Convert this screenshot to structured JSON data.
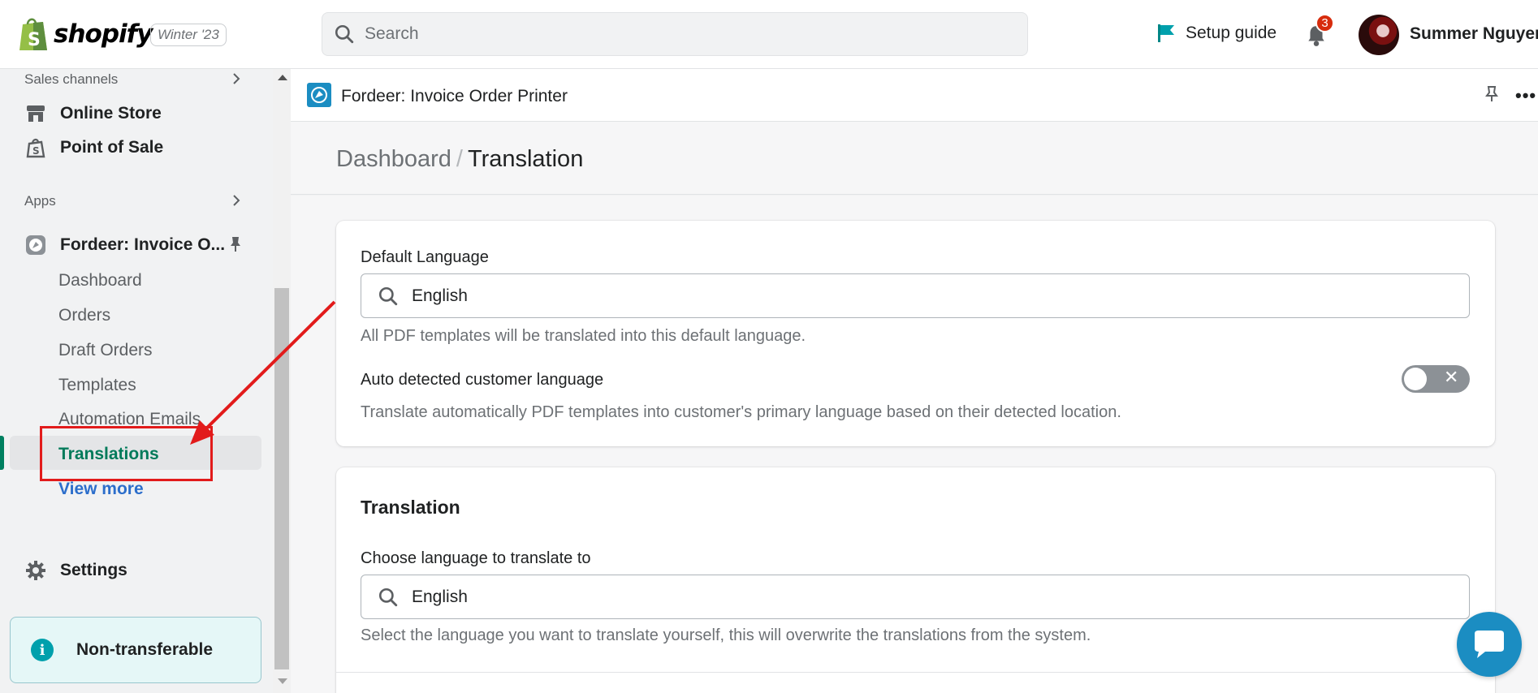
{
  "topbar": {
    "brand": "shopify",
    "version_badge": "Winter '23",
    "search_placeholder": "Search",
    "setup_guide": "Setup guide",
    "notification_count": "3",
    "user_name": "Summer Nguyen"
  },
  "sidebar": {
    "sales_channels_title": "Sales channels",
    "online_store": "Online Store",
    "point_of_sale": "Point of Sale",
    "apps_title": "Apps",
    "app_name": "Fordeer: Invoice O...",
    "sub_items": [
      "Dashboard",
      "Orders",
      "Draft Orders",
      "Templates",
      "Automation Emails"
    ],
    "active_item": "Translations",
    "view_more": "View more",
    "settings": "Settings",
    "banner": "Non-transferable"
  },
  "app": {
    "title": "Fordeer: Invoice Order Printer",
    "breadcrumb_parent": "Dashboard",
    "breadcrumb_separator": "/",
    "breadcrumb_current": "Translation"
  },
  "card1": {
    "default_language_label": "Default Language",
    "default_language_value": "English",
    "default_language_help": "All PDF templates will be translated into this default language.",
    "auto_detect_label": "Auto detected customer language",
    "auto_detect_help": "Translate automatically PDF templates into customer's primary language based on their detected location.",
    "auto_detect_enabled": false
  },
  "card2": {
    "title": "Translation",
    "choose_label": "Choose language to translate to",
    "choose_value": "English",
    "choose_help": "Select the language you want to translate yourself, this will overwrite the translations from the system."
  },
  "colors": {
    "accent_green": "#008060",
    "link_blue": "#2c6ecb",
    "app_blue": "#1b8dc2",
    "annotation_red": "#e21b1b"
  }
}
